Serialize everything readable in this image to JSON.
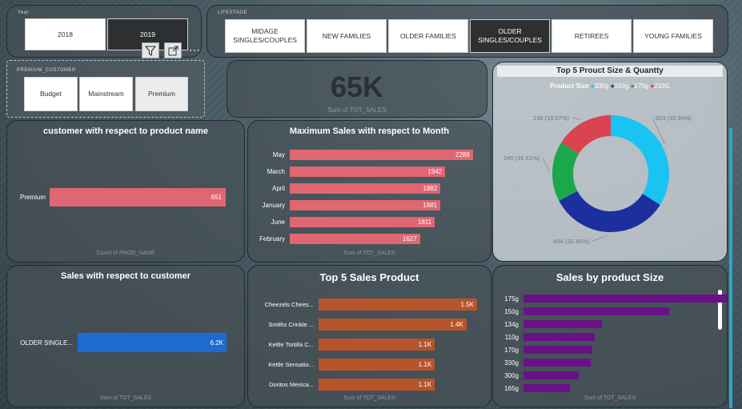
{
  "year_slicer": {
    "label": "Year",
    "options": [
      {
        "label": "2018",
        "selected": false
      },
      {
        "label": "2019",
        "selected": true
      }
    ]
  },
  "lifestage_slicer": {
    "label": "LIFESTAGE",
    "options": [
      {
        "label": "MIDAGE SINGLES/COUPLES",
        "selected": false
      },
      {
        "label": "NEW FAMILIES",
        "selected": false
      },
      {
        "label": "OLDER FAMILIES",
        "selected": false
      },
      {
        "label": "OLDER SINGLES/COUPLES",
        "selected": true
      },
      {
        "label": "RETIREES",
        "selected": false
      },
      {
        "label": "YOUNG FAMILIES",
        "selected": false
      }
    ]
  },
  "premium_slicer": {
    "label": "PREMIUM_CUSTOMER",
    "options": [
      {
        "label": "Budget"
      },
      {
        "label": "Mainstream"
      },
      {
        "label": "Premium"
      }
    ]
  },
  "visual_toolbar": {
    "more": "⋯"
  },
  "kpi": {
    "value": "65K",
    "label": "Sum of TOT_SALES"
  },
  "colors": {
    "pink": "#e06672",
    "orange": "#b8542a",
    "blue": "#1f6bd1",
    "purple": "#6a1188",
    "cyan": "#19c3f2",
    "navy": "#1c2f9e",
    "green": "#1aa84a",
    "red": "#d9424f"
  },
  "chart_data": [
    {
      "type": "bar",
      "title": "customer with respect to product name",
      "categories": [
        "Premium"
      ],
      "values": [
        651
      ],
      "value_labels": [
        "651"
      ],
      "xlabel": "Count of PROD_NAME",
      "xlim": [
        0,
        700
      ]
    },
    {
      "type": "bar",
      "title": "Maximum Sales with respect to Month",
      "categories": [
        "May",
        "March",
        "April",
        "January",
        "June",
        "February"
      ],
      "values": [
        2288,
        1942,
        1882,
        1881,
        1811,
        1627
      ],
      "value_labels": [
        "2288",
        "1942",
        "1882",
        "1881",
        "1811",
        "1627"
      ],
      "xlabel": "Sum of TOT_SALES",
      "xlim": [
        0,
        2300
      ]
    },
    {
      "type": "pie",
      "title": "Top 5 Prouct Size & Quantty",
      "legend_title": "Product Size",
      "legend_position": "top",
      "categories": [
        "330g",
        "150g",
        "170g",
        "210G"
      ],
      "values": [
        503,
        494,
        246,
        238
      ],
      "value_labels": [
        "503 (33.96%)",
        "494 (33.36%)",
        "246 (16.61%)",
        "238 (16.07%)"
      ]
    },
    {
      "type": "bar",
      "title": "Sales with respect to customer",
      "categories": [
        "OLDER SINGLE..."
      ],
      "values": [
        6200
      ],
      "value_labels": [
        "6.2K"
      ],
      "xlabel": "Sum of TOT_SALES",
      "xlim": [
        0,
        6500
      ]
    },
    {
      "type": "bar",
      "title": "Top 5 Sales Product",
      "categories": [
        "Cheezels Chees...",
        "Smiths Crinkle ...",
        "Kettle Tortilla C...",
        "Kettle Sensatio...",
        "Doritos Mexica..."
      ],
      "values": [
        1500,
        1400,
        1100,
        1100,
        1100
      ],
      "value_labels": [
        "1.5K",
        "1.4K",
        "1.1K",
        "1.1K",
        "1.1K"
      ],
      "xlabel": "Sum of TOT_SALES",
      "xlim": [
        0,
        1500
      ]
    },
    {
      "type": "bar",
      "title": "Sales by product Size",
      "categories": [
        "175g",
        "150g",
        "134g",
        "110g",
        "170g",
        "330g",
        "300g",
        "165g"
      ],
      "values": [
        1150,
        820,
        440,
        400,
        390,
        380,
        310,
        260
      ],
      "xlabel": "Sum of TOT_SALES",
      "xlim": [
        0,
        1200
      ]
    }
  ]
}
